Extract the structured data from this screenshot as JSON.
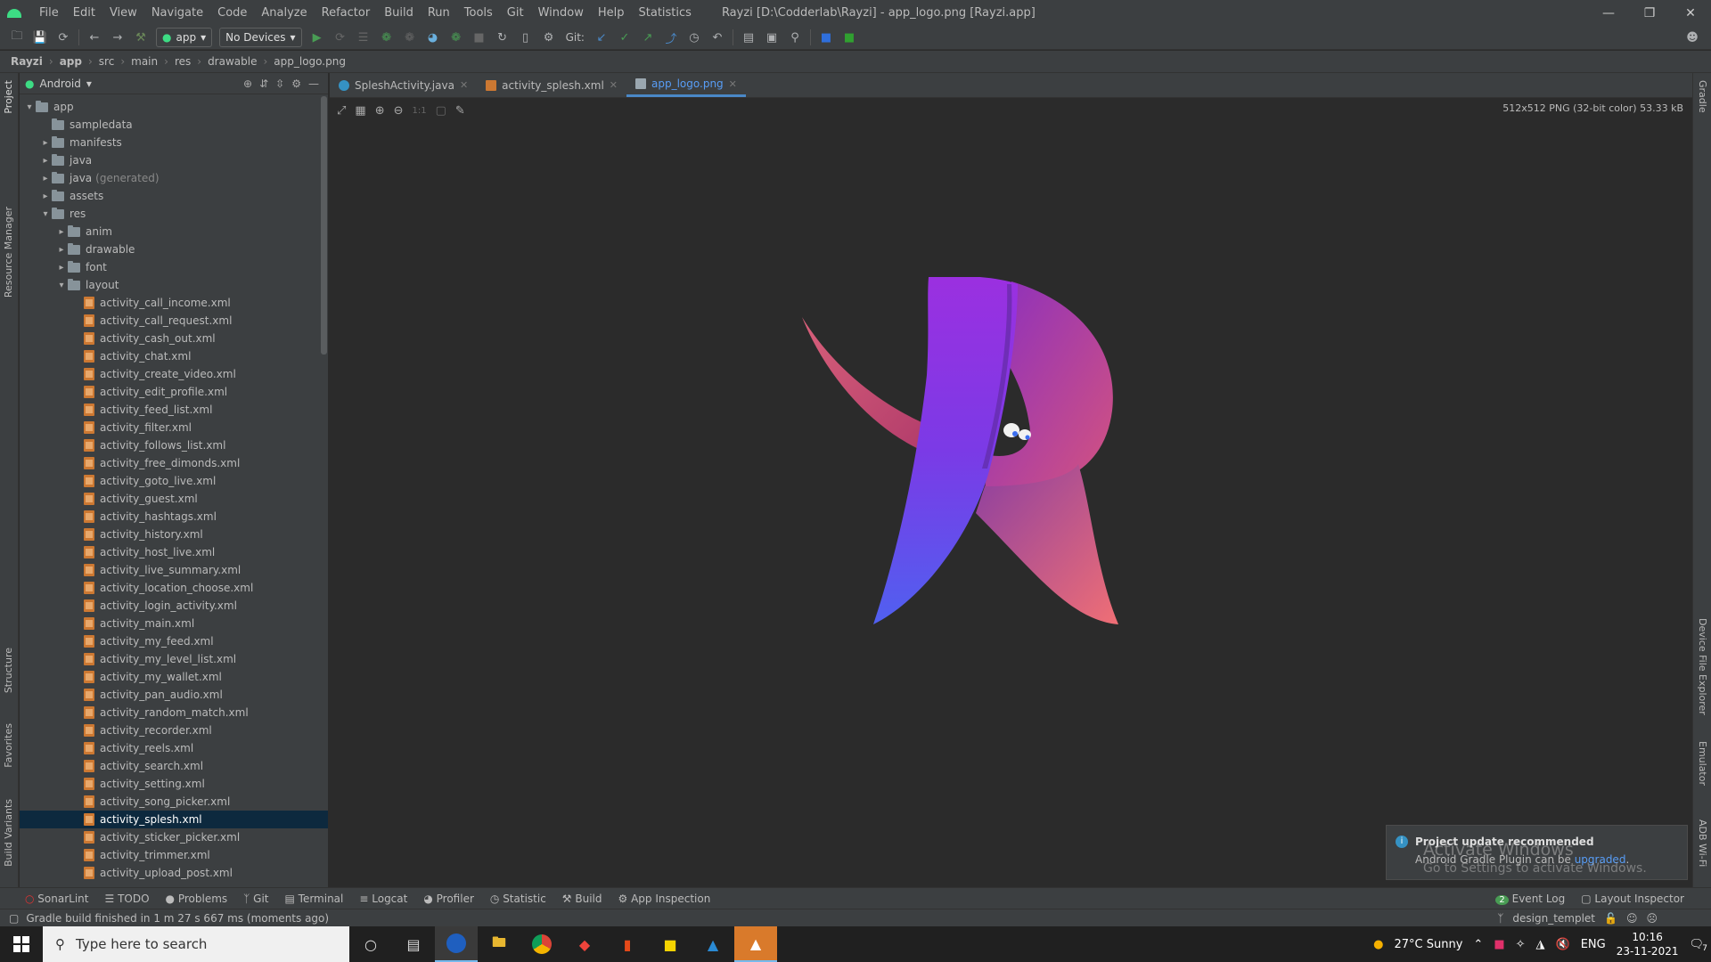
{
  "menu": [
    "File",
    "Edit",
    "View",
    "Navigate",
    "Code",
    "Analyze",
    "Refactor",
    "Build",
    "Run",
    "Tools",
    "Git",
    "Window",
    "Help",
    "Statistics"
  ],
  "window_title": "Rayzi [D:\\Codderlab\\Rayzi] - app_logo.png [Rayzi.app]",
  "toolbar": {
    "config": "app",
    "device": "No Devices",
    "git_label": "Git:"
  },
  "breadcrumb": [
    "Rayzi",
    "app",
    "src",
    "main",
    "res",
    "drawable",
    "app_logo.png"
  ],
  "left_strip": [
    "Project",
    "Resource Manager",
    "Structure",
    "Favorites",
    "Build Variants"
  ],
  "right_strip": [
    "Gradle",
    "Device File Explorer",
    "Emulator",
    "ADB Wi-Fi"
  ],
  "project_view": "Android",
  "tree": {
    "app": "app",
    "sampledata": "sampledata",
    "manifests": "manifests",
    "java": "java",
    "java_gen": "java",
    "java_gen_note": "(generated)",
    "assets": "assets",
    "res": "res",
    "anim": "anim",
    "drawable": "drawable",
    "font": "font",
    "layout": "layout",
    "files": [
      "activity_call_income.xml",
      "activity_call_request.xml",
      "activity_cash_out.xml",
      "activity_chat.xml",
      "activity_create_video.xml",
      "activity_edit_profile.xml",
      "activity_feed_list.xml",
      "activity_filter.xml",
      "activity_follows_list.xml",
      "activity_free_dimonds.xml",
      "activity_goto_live.xml",
      "activity_guest.xml",
      "activity_hashtags.xml",
      "activity_history.xml",
      "activity_host_live.xml",
      "activity_live_summary.xml",
      "activity_location_choose.xml",
      "activity_login_activity.xml",
      "activity_main.xml",
      "activity_my_feed.xml",
      "activity_my_level_list.xml",
      "activity_my_wallet.xml",
      "activity_pan_audio.xml",
      "activity_random_match.xml",
      "activity_recorder.xml",
      "activity_reels.xml",
      "activity_search.xml",
      "activity_setting.xml",
      "activity_song_picker.xml",
      "activity_splesh.xml",
      "activity_sticker_picker.xml",
      "activity_trimmer.xml",
      "activity_upload_post.xml"
    ]
  },
  "tabs": [
    "SpleshActivity.java",
    "activity_splesh.xml",
    "app_logo.png"
  ],
  "image_info": "512x512 PNG (32-bit color) 53.33 kB",
  "zoom_actual": "1:1",
  "toast": {
    "title": "Project update recommended",
    "body": "Android Gradle Plugin can be ",
    "link": "upgraded",
    "after": "."
  },
  "watermark": {
    "line1": "Activate Windows",
    "line2": "Go to Settings to activate Windows."
  },
  "toolwindows": [
    "SonarLint",
    "TODO",
    "Problems",
    "Git",
    "Terminal",
    "Logcat",
    "Profiler",
    "Statistic",
    "Build",
    "App Inspection"
  ],
  "toolwindows_right": [
    "Event Log",
    "Layout Inspector"
  ],
  "event_count": "2",
  "status": "Gradle build finished in 1 m 27 s 667 ms (moments ago)",
  "branch": "design_templet",
  "taskbar": {
    "search_placeholder": "Type here to search",
    "weather": "27°C  Sunny",
    "lang": "ENG",
    "time": "10:16",
    "date": "23-11-2021",
    "notif": "7"
  },
  "colors": {
    "accent": "#4a88c7",
    "selection": "#0d293e",
    "logo_purple": "#8a2be2",
    "logo_pink": "#e0607a"
  }
}
